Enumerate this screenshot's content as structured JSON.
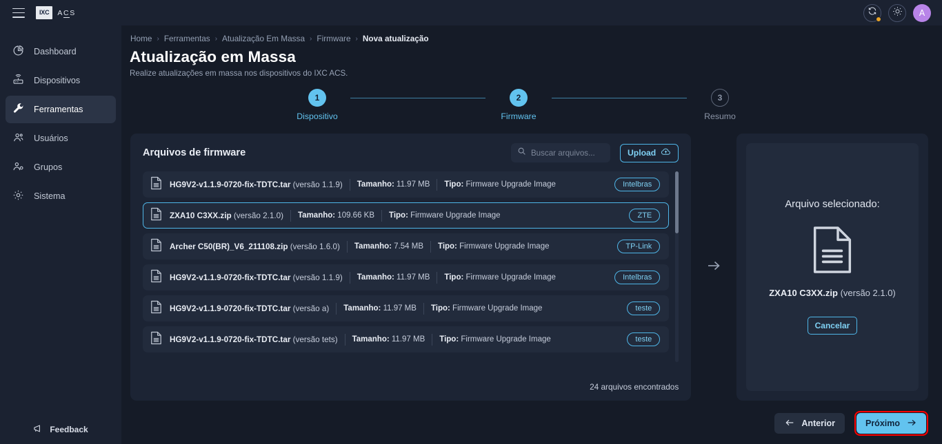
{
  "brand": {
    "mark": "IXC",
    "name": "ACS"
  },
  "sidebar": {
    "items": [
      {
        "label": "Dashboard",
        "icon": "pie-chart-icon"
      },
      {
        "label": "Dispositivos",
        "icon": "router-icon"
      },
      {
        "label": "Ferramentas",
        "icon": "wrench-icon"
      },
      {
        "label": "Usuários",
        "icon": "users-icon"
      },
      {
        "label": "Grupos",
        "icon": "user-group-icon"
      },
      {
        "label": "Sistema",
        "icon": "gear-icon"
      }
    ],
    "active_index": 2,
    "feedback_label": "Feedback"
  },
  "topbar": {
    "sync_icon": "sync-icon",
    "theme_icon": "sun-icon",
    "avatar_initial": "A"
  },
  "breadcrumb": {
    "items": [
      "Home",
      "Ferramentas",
      "Atualização Em Massa",
      "Firmware"
    ],
    "current": "Nova atualização",
    "separator": "›"
  },
  "page": {
    "title": "Atualização em Massa",
    "subtitle": "Realize atualizações em massa nos dispositivos do IXC ACS."
  },
  "stepper": {
    "steps": [
      {
        "number": "1",
        "label": "Dispositivo",
        "state": "done"
      },
      {
        "number": "2",
        "label": "Firmware",
        "state": "done"
      },
      {
        "number": "3",
        "label": "Resumo",
        "state": "todo"
      }
    ]
  },
  "firmware_card": {
    "title": "Arquivos de firmware",
    "search_placeholder": "Buscar arquivos...",
    "search_value": "",
    "upload_label": "Upload",
    "size_label": "Tamanho:",
    "type_label": "Tipo:",
    "found_text": "24 arquivos encontrados",
    "files": [
      {
        "name": "HG9V2-v1.1.9-0720-fix-TDTC.tar",
        "version": "(versão 1.1.9)",
        "size": "11.97 MB",
        "type": "Firmware Upgrade Image",
        "vendor": "Intelbras",
        "selected": false
      },
      {
        "name": "ZXA10 C3XX.zip",
        "version": "(versão 2.1.0)",
        "size": "109.66 KB",
        "type": "Firmware Upgrade Image",
        "vendor": "ZTE",
        "selected": true
      },
      {
        "name": "Archer C50(BR)_V6_211108.zip",
        "version": "(versão 1.6.0)",
        "size": "7.54 MB",
        "type": "Firmware Upgrade Image",
        "vendor": "TP-Link",
        "selected": false
      },
      {
        "name": "HG9V2-v1.1.9-0720-fix-TDTC.tar",
        "version": "(versão 1.1.9)",
        "size": "11.97 MB",
        "type": "Firmware Upgrade Image",
        "vendor": "Intelbras",
        "selected": false
      },
      {
        "name": "HG9V2-v1.1.9-0720-fix-TDTC.tar",
        "version": "(versão a)",
        "size": "11.97 MB",
        "type": "Firmware Upgrade Image",
        "vendor": "teste",
        "selected": false
      },
      {
        "name": "HG9V2-v1.1.9-0720-fix-TDTC.tar",
        "version": "(versão tets)",
        "size": "11.97 MB",
        "type": "Firmware Upgrade Image",
        "vendor": "teste",
        "selected": false
      }
    ]
  },
  "selected_panel": {
    "title": "Arquivo selecionado:",
    "file_name": "ZXA10 C3XX.zip",
    "file_version": "(versão 2.1.0)",
    "cancel_label": "Cancelar",
    "file_icon": "document-icon"
  },
  "footer": {
    "prev_label": "Anterior",
    "next_label": "Próximo"
  },
  "colors": {
    "accent": "#62c3ef",
    "page_bg": "#151b27",
    "card_bg": "#1c2434",
    "row_bg": "#222b3c",
    "highlight_ring": "#ff0000",
    "badge_dot": "#e8a326",
    "avatar": "#b884e8"
  }
}
